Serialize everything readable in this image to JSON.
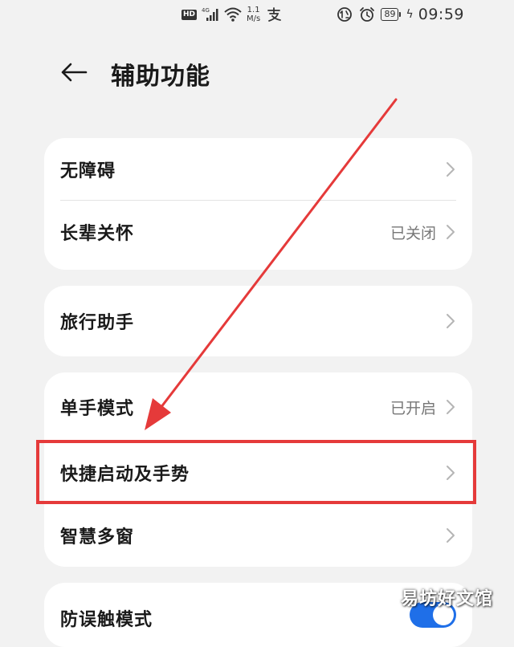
{
  "status_bar": {
    "hd": "HD",
    "network_type": "4G",
    "speed_value": "1.1",
    "speed_unit": "M/s",
    "battery": "89",
    "time": "09:59"
  },
  "header": {
    "title": "辅助功能"
  },
  "groups": [
    {
      "items": [
        {
          "label": "无障碍",
          "value": ""
        },
        {
          "label": "长辈关怀",
          "value": "已关闭"
        }
      ]
    },
    {
      "items": [
        {
          "label": "旅行助手",
          "value": ""
        }
      ]
    },
    {
      "items": [
        {
          "label": "单手模式",
          "value": "已开启"
        },
        {
          "label": "快捷启动及手势",
          "value": ""
        },
        {
          "label": "智慧多窗",
          "value": ""
        }
      ]
    },
    {
      "items": [
        {
          "label": "防误触模式",
          "toggle_on": true
        }
      ]
    }
  ],
  "watermark": "易坊好文馆",
  "colors": {
    "accent_blue": "#1f6fe8",
    "annotation_red": "#e53a3a",
    "background": "#f2f2f2"
  },
  "icons": {
    "back": "arrow-left-icon",
    "chevron": "chevron-right-icon"
  }
}
